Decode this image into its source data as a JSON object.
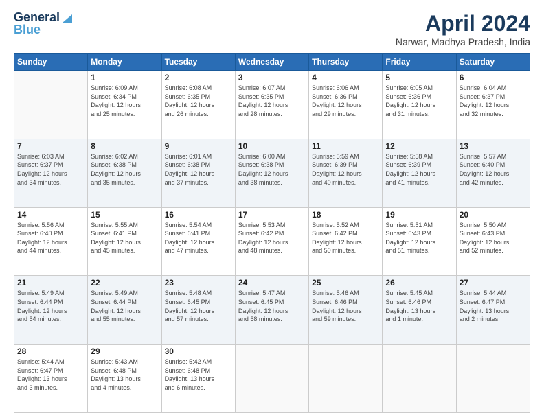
{
  "header": {
    "logo_line1": "General",
    "logo_line2": "Blue",
    "main_title": "April 2024",
    "subtitle": "Narwar, Madhya Pradesh, India"
  },
  "days_of_week": [
    "Sunday",
    "Monday",
    "Tuesday",
    "Wednesday",
    "Thursday",
    "Friday",
    "Saturday"
  ],
  "weeks": [
    [
      {
        "day": "",
        "info": ""
      },
      {
        "day": "1",
        "info": "Sunrise: 6:09 AM\nSunset: 6:34 PM\nDaylight: 12 hours\nand 25 minutes."
      },
      {
        "day": "2",
        "info": "Sunrise: 6:08 AM\nSunset: 6:35 PM\nDaylight: 12 hours\nand 26 minutes."
      },
      {
        "day": "3",
        "info": "Sunrise: 6:07 AM\nSunset: 6:35 PM\nDaylight: 12 hours\nand 28 minutes."
      },
      {
        "day": "4",
        "info": "Sunrise: 6:06 AM\nSunset: 6:36 PM\nDaylight: 12 hours\nand 29 minutes."
      },
      {
        "day": "5",
        "info": "Sunrise: 6:05 AM\nSunset: 6:36 PM\nDaylight: 12 hours\nand 31 minutes."
      },
      {
        "day": "6",
        "info": "Sunrise: 6:04 AM\nSunset: 6:37 PM\nDaylight: 12 hours\nand 32 minutes."
      }
    ],
    [
      {
        "day": "7",
        "info": "Sunrise: 6:03 AM\nSunset: 6:37 PM\nDaylight: 12 hours\nand 34 minutes."
      },
      {
        "day": "8",
        "info": "Sunrise: 6:02 AM\nSunset: 6:38 PM\nDaylight: 12 hours\nand 35 minutes."
      },
      {
        "day": "9",
        "info": "Sunrise: 6:01 AM\nSunset: 6:38 PM\nDaylight: 12 hours\nand 37 minutes."
      },
      {
        "day": "10",
        "info": "Sunrise: 6:00 AM\nSunset: 6:38 PM\nDaylight: 12 hours\nand 38 minutes."
      },
      {
        "day": "11",
        "info": "Sunrise: 5:59 AM\nSunset: 6:39 PM\nDaylight: 12 hours\nand 40 minutes."
      },
      {
        "day": "12",
        "info": "Sunrise: 5:58 AM\nSunset: 6:39 PM\nDaylight: 12 hours\nand 41 minutes."
      },
      {
        "day": "13",
        "info": "Sunrise: 5:57 AM\nSunset: 6:40 PM\nDaylight: 12 hours\nand 42 minutes."
      }
    ],
    [
      {
        "day": "14",
        "info": "Sunrise: 5:56 AM\nSunset: 6:40 PM\nDaylight: 12 hours\nand 44 minutes."
      },
      {
        "day": "15",
        "info": "Sunrise: 5:55 AM\nSunset: 6:41 PM\nDaylight: 12 hours\nand 45 minutes."
      },
      {
        "day": "16",
        "info": "Sunrise: 5:54 AM\nSunset: 6:41 PM\nDaylight: 12 hours\nand 47 minutes."
      },
      {
        "day": "17",
        "info": "Sunrise: 5:53 AM\nSunset: 6:42 PM\nDaylight: 12 hours\nand 48 minutes."
      },
      {
        "day": "18",
        "info": "Sunrise: 5:52 AM\nSunset: 6:42 PM\nDaylight: 12 hours\nand 50 minutes."
      },
      {
        "day": "19",
        "info": "Sunrise: 5:51 AM\nSunset: 6:43 PM\nDaylight: 12 hours\nand 51 minutes."
      },
      {
        "day": "20",
        "info": "Sunrise: 5:50 AM\nSunset: 6:43 PM\nDaylight: 12 hours\nand 52 minutes."
      }
    ],
    [
      {
        "day": "21",
        "info": "Sunrise: 5:49 AM\nSunset: 6:44 PM\nDaylight: 12 hours\nand 54 minutes."
      },
      {
        "day": "22",
        "info": "Sunrise: 5:49 AM\nSunset: 6:44 PM\nDaylight: 12 hours\nand 55 minutes."
      },
      {
        "day": "23",
        "info": "Sunrise: 5:48 AM\nSunset: 6:45 PM\nDaylight: 12 hours\nand 57 minutes."
      },
      {
        "day": "24",
        "info": "Sunrise: 5:47 AM\nSunset: 6:45 PM\nDaylight: 12 hours\nand 58 minutes."
      },
      {
        "day": "25",
        "info": "Sunrise: 5:46 AM\nSunset: 6:46 PM\nDaylight: 12 hours\nand 59 minutes."
      },
      {
        "day": "26",
        "info": "Sunrise: 5:45 AM\nSunset: 6:46 PM\nDaylight: 13 hours\nand 1 minute."
      },
      {
        "day": "27",
        "info": "Sunrise: 5:44 AM\nSunset: 6:47 PM\nDaylight: 13 hours\nand 2 minutes."
      }
    ],
    [
      {
        "day": "28",
        "info": "Sunrise: 5:44 AM\nSunset: 6:47 PM\nDaylight: 13 hours\nand 3 minutes."
      },
      {
        "day": "29",
        "info": "Sunrise: 5:43 AM\nSunset: 6:48 PM\nDaylight: 13 hours\nand 4 minutes."
      },
      {
        "day": "30",
        "info": "Sunrise: 5:42 AM\nSunset: 6:48 PM\nDaylight: 13 hours\nand 6 minutes."
      },
      {
        "day": "",
        "info": ""
      },
      {
        "day": "",
        "info": ""
      },
      {
        "day": "",
        "info": ""
      },
      {
        "day": "",
        "info": ""
      }
    ]
  ]
}
